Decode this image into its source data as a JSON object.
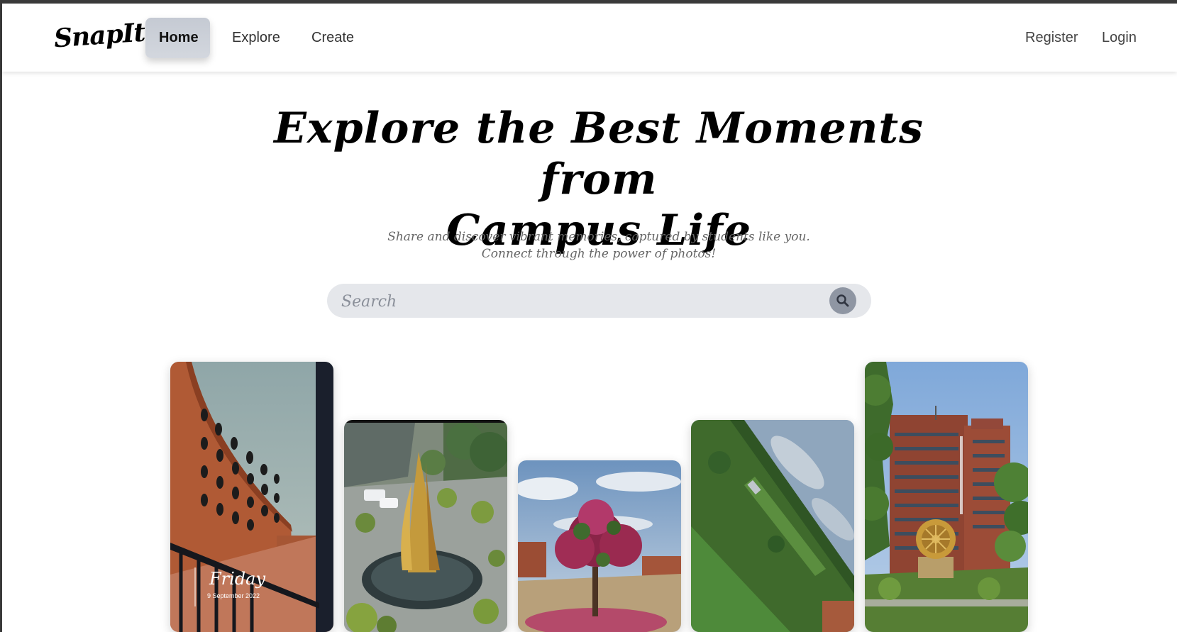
{
  "app": {
    "brand": "SnapIt"
  },
  "nav": {
    "home": "Home",
    "explore": "Explore",
    "create": "Create",
    "register": "Register",
    "login": "Login",
    "active": "Home"
  },
  "hero": {
    "title_line1": "Explore the Best Moments from",
    "title_line2": "Campus Life",
    "subtitle_line1": "Share and discover vibrant memories, captured by students like you.",
    "subtitle_line2": "Connect through the power of photos!"
  },
  "search": {
    "placeholder": "Search",
    "value": "",
    "icon": "search-icon"
  },
  "gallery": {
    "photos": [
      {
        "name": "curved-brick-building-photo",
        "overlay_day": "Friday",
        "overlay_date": "9 September 2022"
      },
      {
        "name": "golden-sculpture-photo"
      },
      {
        "name": "flowering-tree-photo"
      },
      {
        "name": "tilted-landscape-photo"
      },
      {
        "name": "ashoka-chakra-building-photo"
      }
    ]
  },
  "colors": {
    "nav_active_bg": "#c9cdd5",
    "search_bg": "#e5e7eb",
    "search_button": "#8f96a3",
    "subtitle_text": "#666666"
  }
}
